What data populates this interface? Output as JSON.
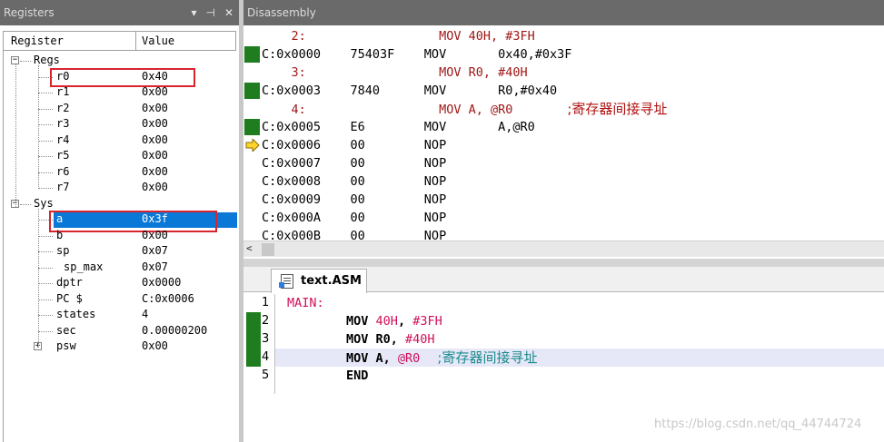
{
  "registers": {
    "title": "Registers",
    "title_icons": [
      "▾",
      "ᵮ",
      "✕"
    ],
    "col_register": "Register",
    "col_value": "Value",
    "groups": [
      {
        "label": "Regs",
        "rows": [
          {
            "name": "r0",
            "value": "0x40"
          },
          {
            "name": "r1",
            "value": "0x00"
          },
          {
            "name": "r2",
            "value": "0x00"
          },
          {
            "name": "r3",
            "value": "0x00"
          },
          {
            "name": "r4",
            "value": "0x00"
          },
          {
            "name": "r5",
            "value": "0x00"
          },
          {
            "name": "r6",
            "value": "0x00"
          },
          {
            "name": "r7",
            "value": "0x00"
          }
        ]
      },
      {
        "label": "Sys",
        "rows": [
          {
            "name": "a",
            "value": "0x3f"
          },
          {
            "name": "b",
            "value": "0x00"
          },
          {
            "name": "sp",
            "value": "0x07"
          },
          {
            "name": "sp_max",
            "value": "0x07"
          },
          {
            "name": "dptr",
            "value": "0x0000"
          },
          {
            "name": "PC  $",
            "value": "C:0x0006"
          },
          {
            "name": "states",
            "value": "4"
          },
          {
            "name": "sec",
            "value": "0.00000200"
          },
          {
            "name": "psw",
            "value": "0x00"
          }
        ]
      }
    ],
    "selected": "a",
    "expander_minus": "−",
    "expander_plus": "+"
  },
  "disassembly": {
    "title": "Disassembly",
    "rows": [
      {
        "kind": "src",
        "text": "    2:                  MOV 40H, #3FH"
      },
      {
        "kind": "code",
        "text": "C:0x0000    75403F    MOV       0x40,#0x3F",
        "mark": true
      },
      {
        "kind": "src",
        "text": "    3:                  MOV R0, #40H"
      },
      {
        "kind": "code",
        "text": "C:0x0003    7840      MOV       R0,#0x40",
        "mark": true
      },
      {
        "kind": "src",
        "text": "    4:                  MOV A, @R0",
        "comment": ";寄存器间接寻址"
      },
      {
        "kind": "code",
        "text": "C:0x0005    E6        MOV       A,@R0",
        "mark": true
      },
      {
        "kind": "code",
        "text": "C:0x0006    00        NOP",
        "arrow": true
      },
      {
        "kind": "code",
        "text": "C:0x0007    00        NOP"
      },
      {
        "kind": "code",
        "text": "C:0x0008    00        NOP"
      },
      {
        "kind": "code",
        "text": "C:0x0009    00        NOP"
      },
      {
        "kind": "code",
        "text": "C:0x000A    00        NOP"
      },
      {
        "kind": "code",
        "text": "C:0x000B    00        NOP"
      }
    ],
    "scroll_left": "<"
  },
  "editor": {
    "tab_label": "text.ASM",
    "lines": [
      {
        "no": "1",
        "mark": false,
        "parts": [
          {
            "cls": "lbl",
            "t": "MAIN:"
          }
        ]
      },
      {
        "no": "2",
        "mark": true,
        "parts": [
          {
            "cls": "kw",
            "t": "        MOV "
          },
          {
            "cls": "num",
            "t": "40H"
          },
          {
            "cls": "kw",
            "t": ", "
          },
          {
            "cls": "num",
            "t": "#3FH"
          }
        ]
      },
      {
        "no": "3",
        "mark": true,
        "parts": [
          {
            "cls": "kw",
            "t": "        MOV R0, "
          },
          {
            "cls": "num",
            "t": "#40H"
          }
        ]
      },
      {
        "no": "4",
        "mark": true,
        "parts": [
          {
            "cls": "kw",
            "t": "        MOV A, "
          },
          {
            "cls": "num",
            "t": "@R0"
          },
          {
            "cls": "cmt",
            "t": "    ;寄存器间接寻址"
          }
        ]
      },
      {
        "no": "5",
        "mark": false,
        "parts": [
          {
            "cls": "kw",
            "t": "        END"
          }
        ]
      }
    ]
  },
  "watermark": "https://blog.csdn.net/qq_44744724",
  "colors": {
    "marker_green": "#1f7d1f",
    "highlight_red": "#d9242e",
    "selection_blue": "#0a78d7"
  }
}
